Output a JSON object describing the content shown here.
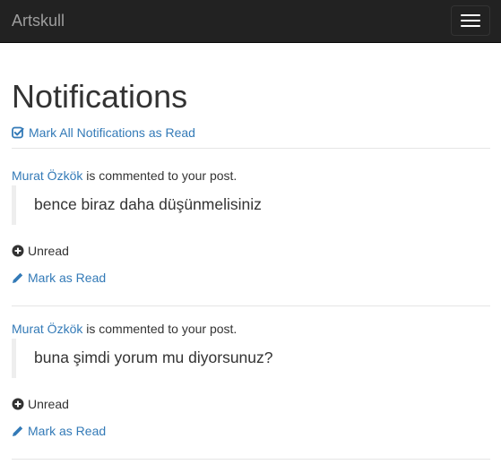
{
  "navbar": {
    "brand": "Artskull",
    "menu_icon": "hamburger-icon"
  },
  "page": {
    "title": "Notifications",
    "mark_all_label": "Mark All Notifications as Read",
    "mark_all_icon": "check-square-icon"
  },
  "notifications": [
    {
      "user": "Murat Özkök",
      "action_text": " is commented to your post.",
      "comment": "bence biraz daha düşünmelisiniz",
      "status": "Unread",
      "status_icon": "plus-circle-icon",
      "mark_read_label": "Mark as Read",
      "mark_read_icon": "pencil-icon"
    },
    {
      "user": "Murat Özkök",
      "action_text": " is commented to your post.",
      "comment": "buna şimdi yorum mu diyorsunuz?",
      "status": "Unread",
      "status_icon": "plus-circle-icon",
      "mark_read_label": "Mark as Read",
      "mark_read_icon": "pencil-icon"
    }
  ],
  "colors": {
    "navbar_bg": "#222222",
    "link": "#337ab7",
    "text": "#333333"
  }
}
